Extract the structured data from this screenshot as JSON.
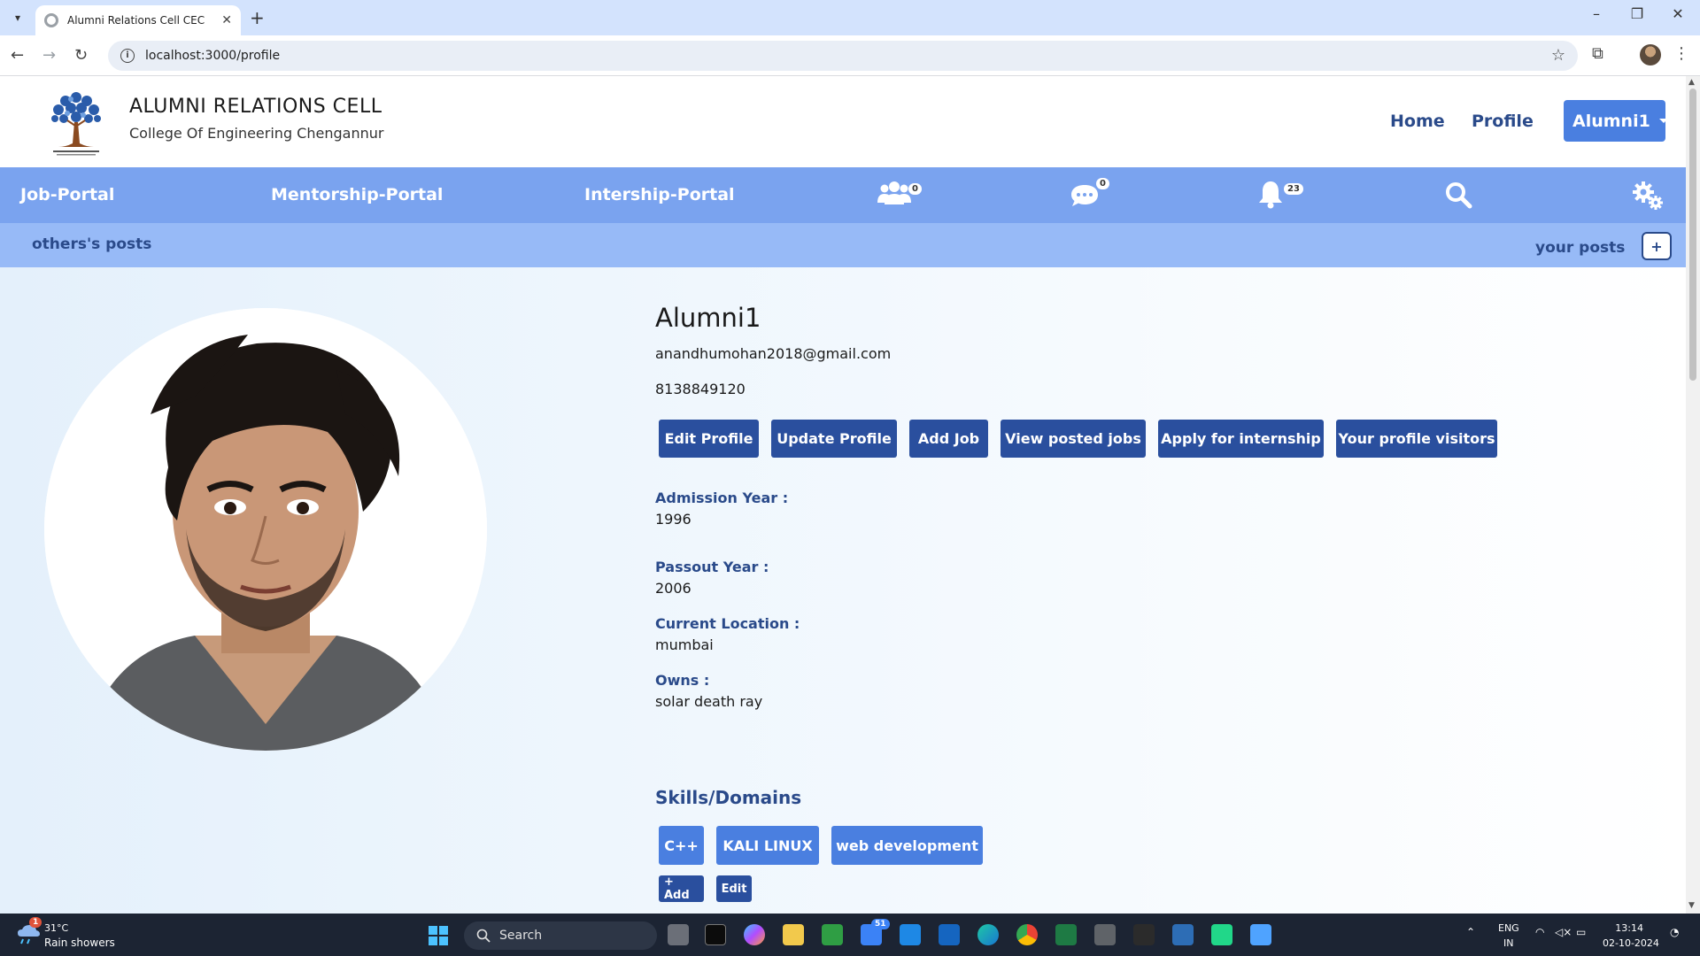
{
  "browser": {
    "tab_title": "Alumni Relations Cell CEC",
    "url": "localhost:3000/profile"
  },
  "header": {
    "title": "ALUMNI RELATIONS CELL",
    "subtitle": "College Of Engineering Chengannur",
    "nav": {
      "home": "Home",
      "profile": "Profile"
    },
    "user_menu": "Alumni1"
  },
  "portal_bar": {
    "job": "Job-Portal",
    "mentorship": "Mentorship-Portal",
    "internship": "Intership-Portal",
    "friends_count": "0",
    "messages_count": "0",
    "notifications_count": "23"
  },
  "posts_bar": {
    "others": "others's posts",
    "yours": "your posts",
    "add": "+"
  },
  "profile": {
    "name": "Alumni1",
    "email": "anandhumohan2018@gmail.com",
    "phone": "8138849120",
    "actions": {
      "edit_profile": "Edit Profile",
      "update_profile": "Update Profile",
      "add_job": "Add Job",
      "view_posted_jobs": "View posted jobs",
      "apply_internship": "Apply for internship",
      "profile_visitors": "Your profile visitors"
    },
    "fields": {
      "admission_label": "Admission Year :",
      "admission_value": "1996",
      "passout_label": "Passout Year :",
      "passout_value": "2006",
      "location_label": "Current Location :",
      "location_value": "mumbai",
      "owns_label": "Owns :",
      "owns_value": "solar death ray"
    },
    "skills_title": "Skills/Domains",
    "skills": [
      "C++",
      "KALI LINUX",
      "web development"
    ],
    "skills_add": "+ Add",
    "skills_edit": "Edit"
  },
  "taskbar": {
    "weather_temp": "31°C",
    "weather_desc": "Rain showers",
    "weather_badge": "1",
    "search_label": "Search",
    "mail_badge": "51",
    "lang_1": "ENG",
    "lang_2": "IN",
    "time": "13:14",
    "date": "02-10-2024"
  },
  "colors": {
    "primary_blue": "#7aa3ef",
    "sub_blue": "#97baf7",
    "button_navy": "#2a4f9e",
    "chip_blue": "#4a7fe0"
  }
}
